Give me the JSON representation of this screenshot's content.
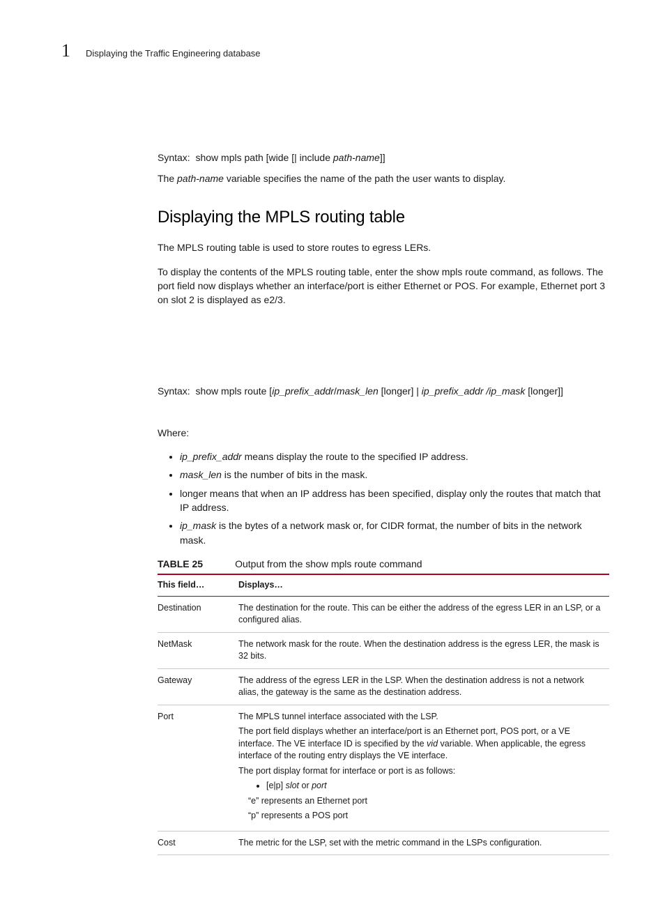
{
  "header": {
    "chapter_number": "1",
    "running_title": "Displaying the Traffic Engineering database"
  },
  "intro": {
    "syntax_prefix": "Syntax:",
    "syntax1_a": "show mpls path [wide [| include ",
    "syntax1_b": "path-name",
    "syntax1_c": "]]",
    "para1_a": "The ",
    "para1_b": "path-name",
    "para1_c": " variable specifies the name of the path the user wants to display."
  },
  "section": {
    "heading": "Displaying the MPLS routing table",
    "para1": "The MPLS routing table is used to store routes to egress LERs.",
    "para2": "To display the contents of the MPLS routing table, enter the show mpls route command, as follows. The port field now displays whether an interface/port is either Ethernet or POS. For example, Ethernet port 3 on slot 2 is displayed as e2/3.",
    "syntax2_prefix": "Syntax:",
    "syntax2_a": "show mpls route [",
    "syntax2_b": "ip_prefix_addr",
    "syntax2_c": "/",
    "syntax2_d": "mask_len",
    "syntax2_e": " [longer] | ",
    "syntax2_f": "ip_prefix_addr /ip_mask",
    "syntax2_g": " [longer]]",
    "where_label": "Where:",
    "bullets": {
      "b1_a": "ip_prefix_addr",
      "b1_b": " means display the route to the specified IP address.",
      "b2_a": "mask_len",
      "b2_b": " is the number of bits in the mask.",
      "b3": "longer means that when an IP address has been specified, display only the routes that match that IP address.",
      "b4_a": "ip_mask",
      "b4_b": " is the bytes of a network mask or, for CIDR format, the number of bits in the network mask."
    }
  },
  "table": {
    "label": "TABLE 25",
    "caption": "Output from the show mpls route command",
    "headers": {
      "col1": "This field…",
      "col2": "Displays…"
    },
    "rows": {
      "destination": {
        "field": "Destination",
        "desc": "The destination for the route. This can be either the address of the egress LER in an LSP, or a configured alias."
      },
      "netmask": {
        "field": "NetMask",
        "desc": "The network mask for the route. When the destination address is the egress LER, the mask is 32 bits."
      },
      "gateway": {
        "field": "Gateway",
        "desc": "The address of the egress LER in the LSP. When the destination address is not a network alias, the gateway is the same as the destination address."
      },
      "port": {
        "field": "Port",
        "p1": "The MPLS tunnel interface associated with the LSP.",
        "p2a": "The port field displays whether an interface/port is an Ethernet port, POS port, or a VE interface. The VE interface ID is specified by the ",
        "p2b": "vid",
        "p2c": " variable. When applicable, the egress interface of the routing entry displays the VE interface.",
        "p3": "The port display format for interface or port is as follows:",
        "li_a": "[e|p] ",
        "li_b": "slot",
        "li_c": " or ",
        "li_d": "port",
        "p4": "“e” represents an Ethernet port",
        "p5": "“p” represents a POS port"
      },
      "cost": {
        "field": "Cost",
        "desc": "The metric for the LSP, set with the metric command in the LSPs configuration."
      }
    }
  }
}
